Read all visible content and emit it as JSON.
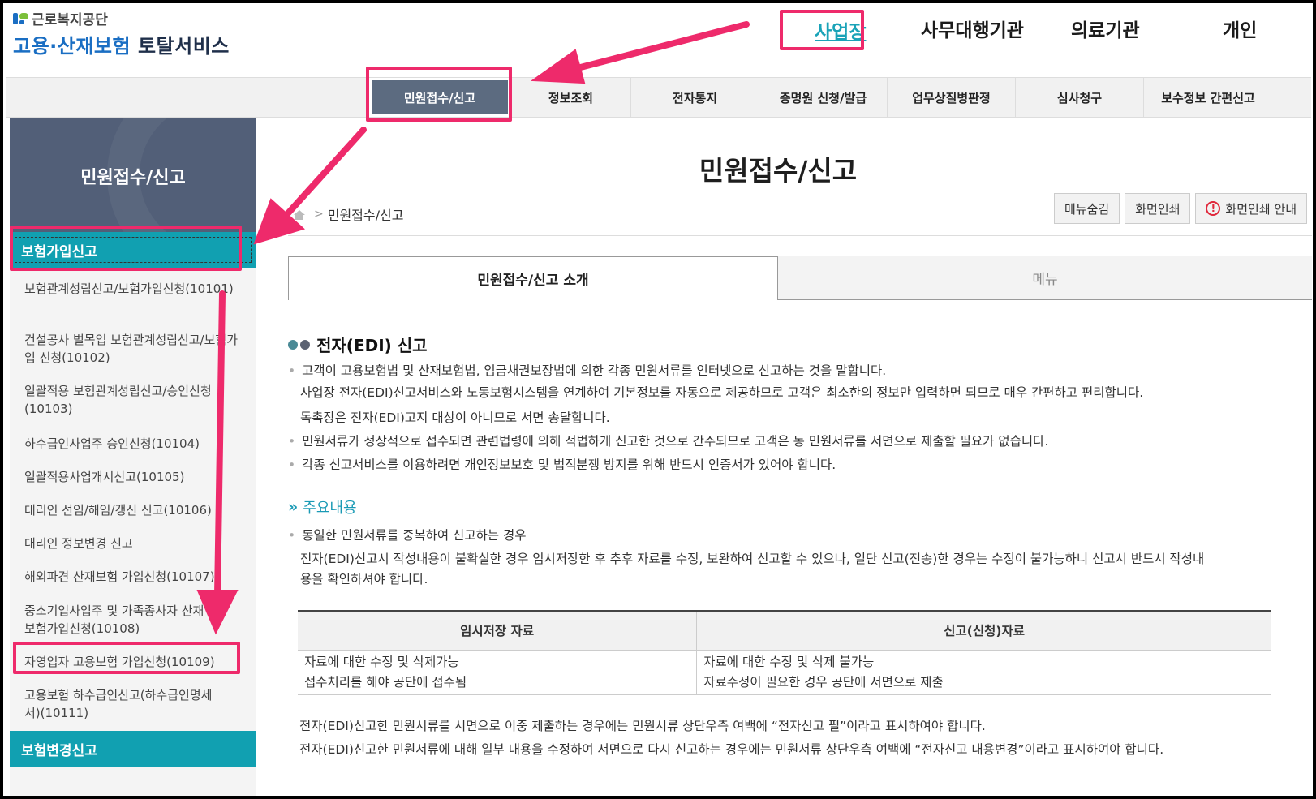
{
  "header": {
    "org_name": "근로복지공단",
    "service_prefix": "고용·산재보험",
    "service_suffix": " 토탈서비스",
    "user_types": [
      "사업장",
      "사무대행기관",
      "의료기관",
      "개인"
    ]
  },
  "gnb": [
    "민원접수/신고",
    "정보조회",
    "전자통지",
    "증명원 신청/발급",
    "업무상질병판정",
    "심사청구",
    "보수정보 간편신고"
  ],
  "sidebar": {
    "title": "민원접수/신고",
    "category_active": "보험가입신고",
    "items": [
      "보험관계성립신고/보험가입신청(10101)",
      "건설공사 벌목업 보험관계성립신고/보험가입 신청(10102)",
      "일괄적용 보험관계성립신고/승인신청(10103)",
      "하수급인사업주 승인신청(10104)",
      "일괄적용사업개시신고(10105)",
      "대리인 선임/해임/갱신 신고(10106)",
      "대리인 정보변경 신고",
      "해외파견 산재보험 가입신청(10107)",
      "중소기업사업주 및 가족종사자 산재보험가입신청(10108)",
      "자영업자 고용보험 가입신청(10109)",
      "고용보험 하수급인신고(하수급인명세서)(10111)"
    ],
    "category_next": "보험변경신고"
  },
  "main": {
    "title": "민원접수/신고",
    "breadcrumb": "민원접수/신고",
    "util_buttons": {
      "hide_menu": "메뉴숨김",
      "print": "화면인쇄",
      "print_guide": "화면인쇄 안내"
    },
    "tabs": [
      "민원접수/신고 소개",
      "메뉴"
    ],
    "edi_heading": "전자(EDI) 신고",
    "edi_paragraphs": [
      "고객이 고용보험법 및 산재보험법, 임금채권보장법에 의한 각종 민원서류를 인터넷으로 신고하는 것을 말합니다.",
      "사업장 전자(EDI)신고서비스와 노동보험시스템을 연계하여 기본정보를 자동으로 제공하므로 고객은 최소한의 정보만 입력하면 되므로 매우 간편하고 편리합니다.",
      "독촉장은 전자(EDI)고지 대상이 아니므로 서면 송달합니다.",
      "민원서류가 정상적으로 접수되면 관련법령에 의해 적법하게 신고한 것으로 간주되므로 고객은 동 민원서류를 서면으로 제출할 필요가 없습니다.",
      "각종 신고서비스를 이용하려면 개인정보보호 및 법적분쟁 방지를 위해 반드시 인증서가 있어야 합니다."
    ],
    "key_heading": "주요내용",
    "key_paragraphs": [
      "동일한 민원서류를 중복하여 신고하는 경우",
      "전자(EDI)신고시 작성내용이 불확실한 경우 임시저장한 후 추후 자료를 수정, 보완하여 신고할 수 있으나, 일단 신고(전송)한 경우는 수정이 불가능하니 신고시 반드시 작성내",
      "용을 확인하셔야 합니다."
    ],
    "table": {
      "headers": [
        "임시저장 자료",
        "신고(신청)자료"
      ],
      "col1": [
        "자료에 대한 수정 및 삭제가능",
        "접수처리를 해야 공단에 접수됨"
      ],
      "col2": [
        "자료에 대한 수정 및 삭제 불가능",
        "자료수정이 필요한 경우 공단에 서면으로 제출"
      ]
    },
    "notes": [
      "전자(EDI)신고한 민원서류를 서면으로 이중 제출하는 경우에는 민원서류 상단우측 여백에 “전자신고 필”이라고 표시하여야 합니다.",
      "전자(EDI)신고한 민원서류에 대해 일부 내용을 수정하여 서면으로 다시 신고하는 경우에는 민원서류 상단우측 여백에 “전자신고 내용변경”이라고 표시하여야 합니다."
    ]
  },
  "colors": {
    "highlight": "#ee2a6b",
    "teal": "#11a0b1",
    "sidebar_head": "#525f78",
    "gnb_active": "#5c6b80",
    "link_teal": "#1aa3b8"
  }
}
